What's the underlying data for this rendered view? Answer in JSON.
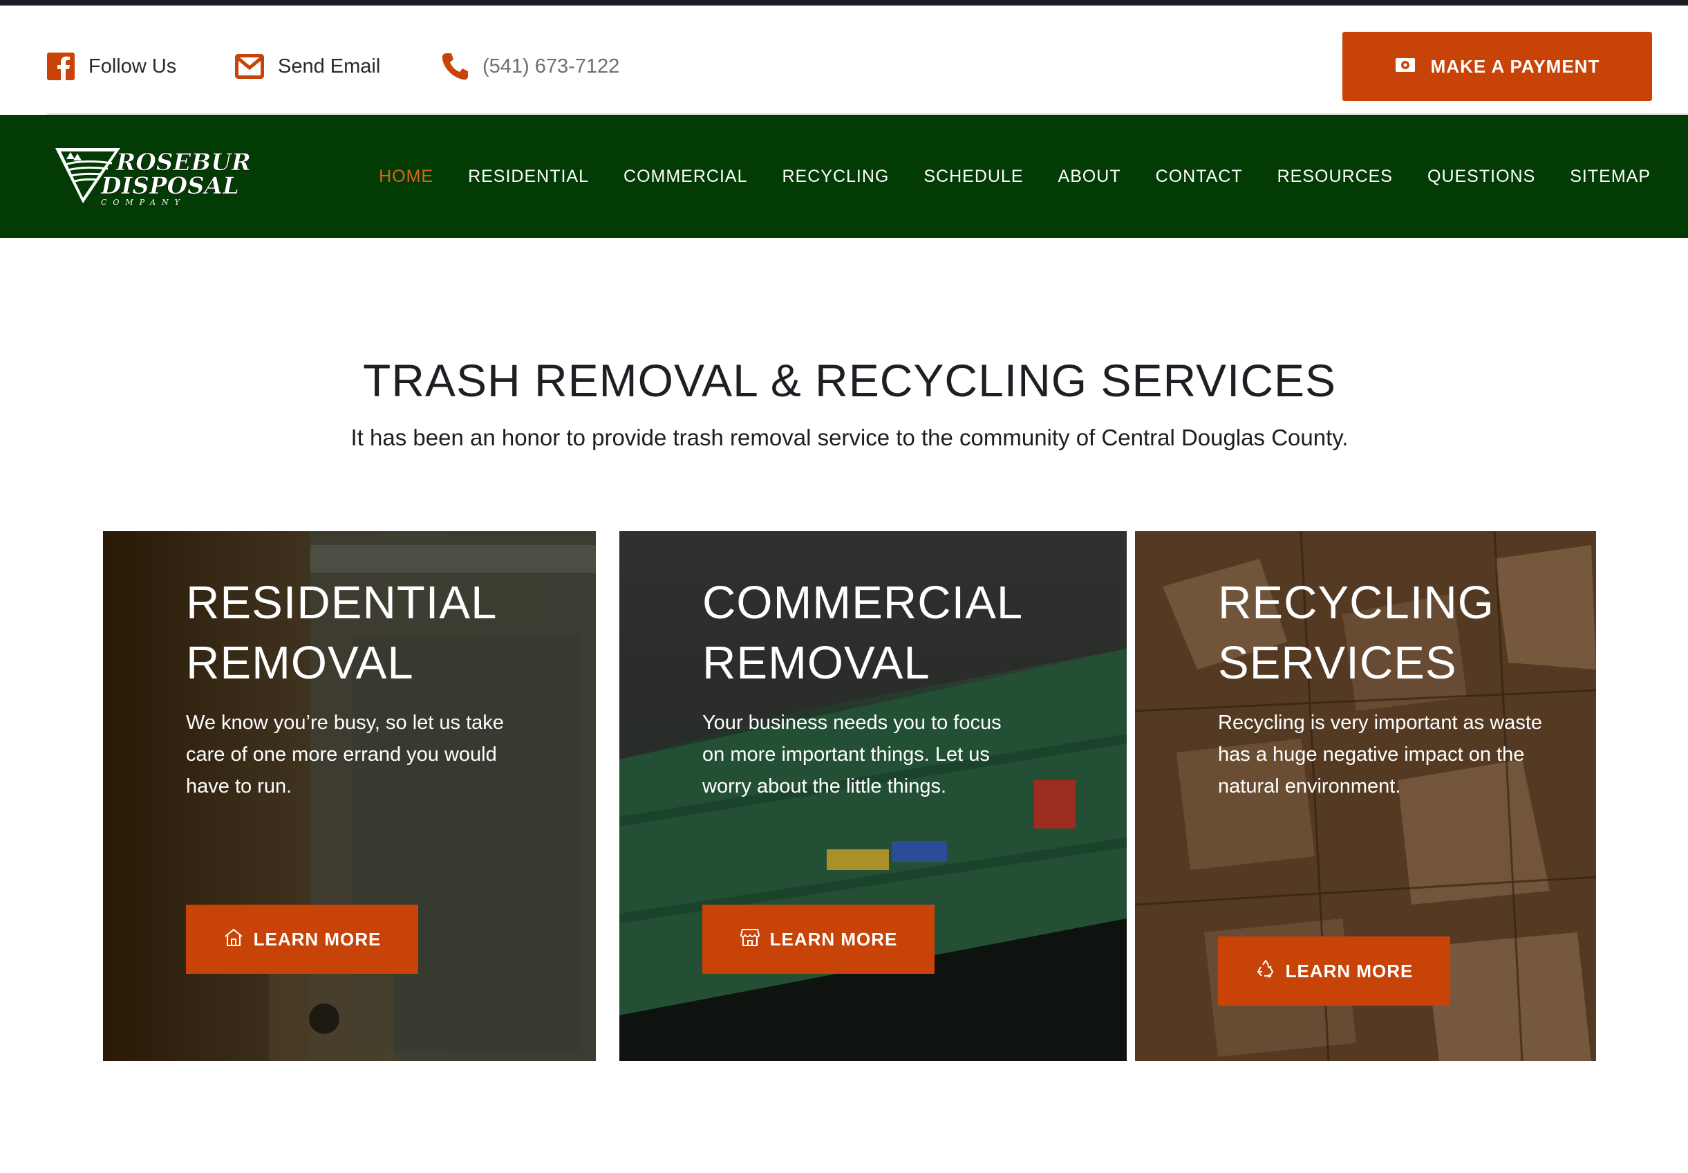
{
  "topbar": {
    "follow_label": "Follow Us",
    "email_label": "Send Email",
    "phone_label": "(541) 673-7122",
    "payment_label": "MAKE A PAYMENT"
  },
  "brand": {
    "logo_line1": "ROSEBURG",
    "logo_line2": "DISPOSAL",
    "logo_line3": "COMPANY"
  },
  "nav": {
    "items": [
      {
        "label": "HOME",
        "active": true
      },
      {
        "label": "RESIDENTIAL"
      },
      {
        "label": "COMMERCIAL"
      },
      {
        "label": "RECYCLING"
      },
      {
        "label": "SCHEDULE"
      },
      {
        "label": "ABOUT"
      },
      {
        "label": "CONTACT"
      },
      {
        "label": "RESOURCES"
      },
      {
        "label": "QUESTIONS"
      },
      {
        "label": "SITEMAP"
      }
    ]
  },
  "hero": {
    "title": "TRASH REMOVAL & RECYCLING SERVICES",
    "subtitle": "It has been an honor to provide trash removal service to the community of Central Douglas County."
  },
  "cards": [
    {
      "title_line1": "RESIDENTIAL",
      "title_line2": "REMOVAL",
      "text": "We know you’re busy, so let us take care of one more errand you would have to run.",
      "button": "LEARN MORE"
    },
    {
      "title_line1": "COMMERCIAL",
      "title_line2": "REMOVAL",
      "text": "Your business needs you to focus on more important things. Let us worry about the little things.",
      "button": "LEARN MORE"
    },
    {
      "title_line1": "RECYCLING",
      "title_line2": "SERVICES",
      "text": "Recycling is very important as waste has a huge negative impact on the natural environment.",
      "button": "LEARN MORE"
    }
  ],
  "colors": {
    "accent": "#c84307",
    "nav_bg": "#033b04",
    "nav_active": "#d9641e"
  }
}
